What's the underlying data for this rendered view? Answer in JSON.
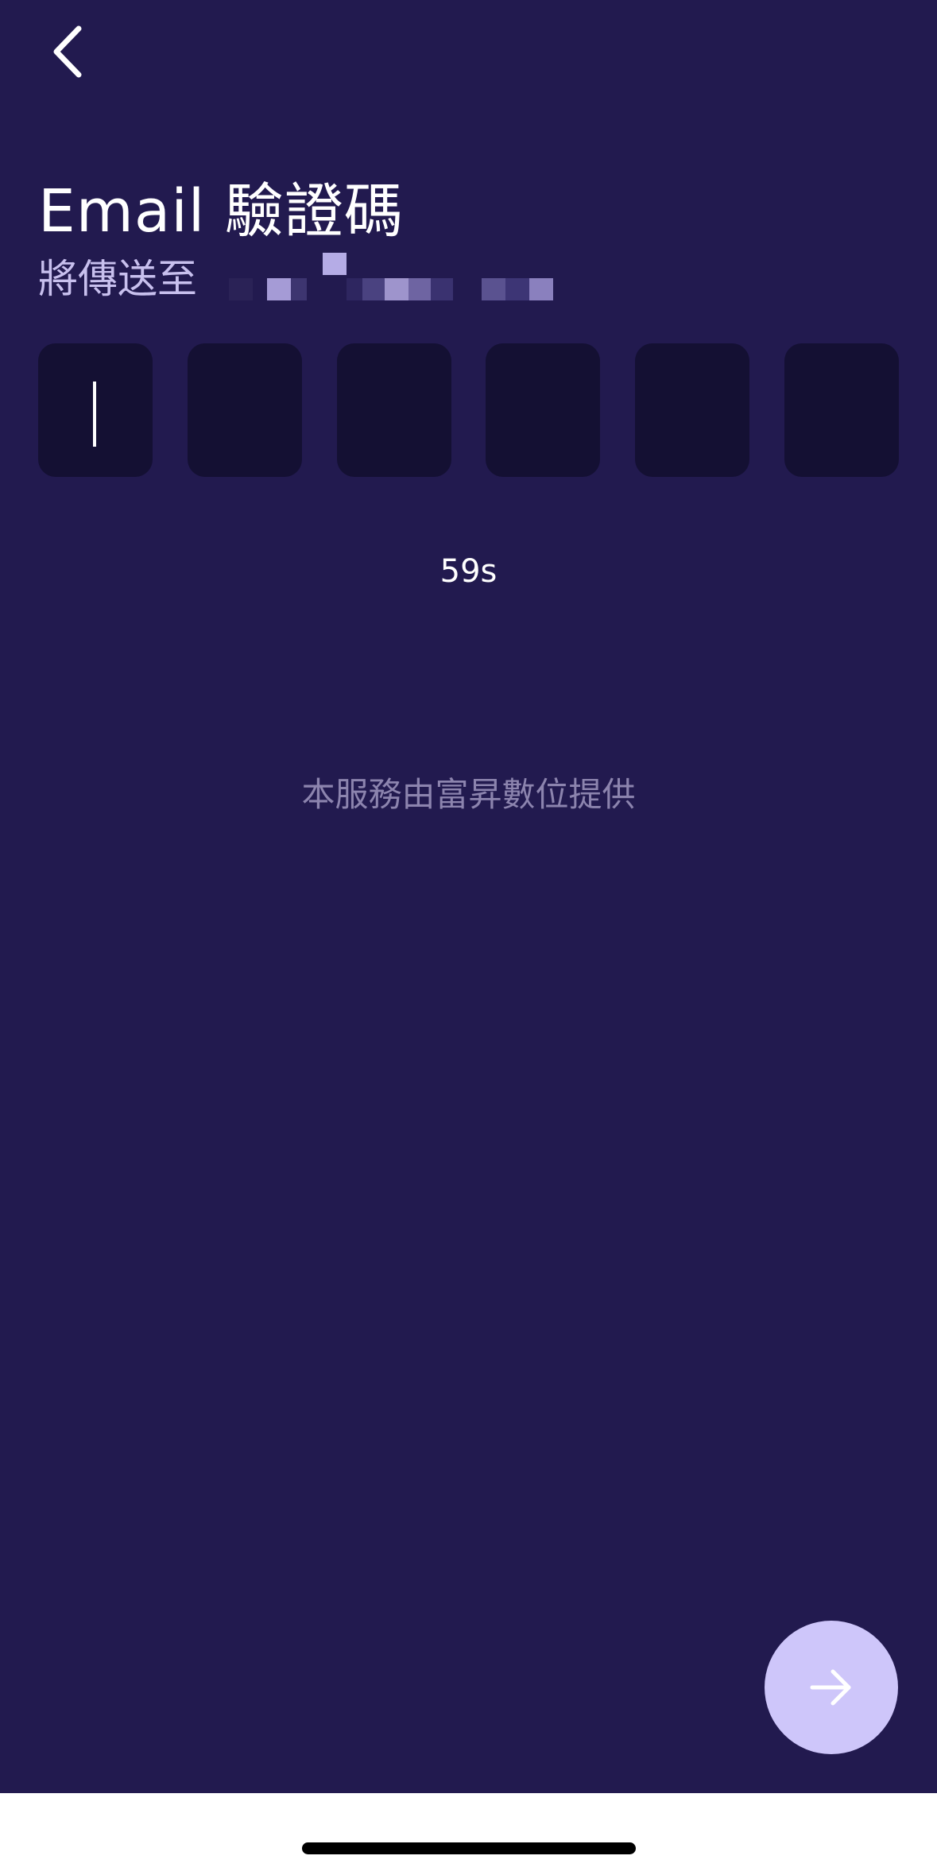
{
  "header": {
    "back_icon": "chevron-left-icon",
    "title": "Email 驗證碼",
    "subtitle": "將傳送至"
  },
  "otp": {
    "length": 6,
    "values": [
      "",
      "",
      "",
      "",
      "",
      ""
    ],
    "active_index": 0
  },
  "countdown": "59s",
  "provider_text": "本服務由富昇數位提供",
  "next_button": {
    "icon": "arrow-right-icon"
  },
  "colors": {
    "background": "#221A4F",
    "otp_box": "#141033",
    "accent": "#CEC6FA",
    "subtitle": "#C8C0EE",
    "muted_text": "#8C84AE"
  }
}
